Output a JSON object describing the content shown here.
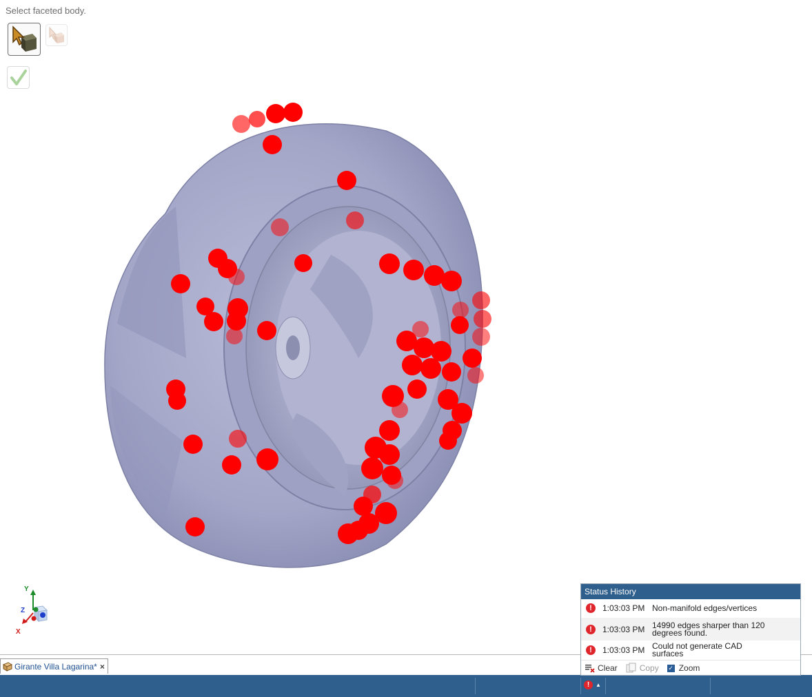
{
  "prompt": {
    "text": "Select faceted body."
  },
  "colors": {
    "accent": "#2f5f8c",
    "error_marker": "#ff0000",
    "model": "#a6a8c9",
    "error_icon": "#e0262d"
  },
  "tools": {
    "select": {
      "icon": "select-body-icon"
    },
    "select_faded": {
      "icon": "select-body-faded-icon"
    },
    "accept": {
      "icon": "checkmark-icon"
    }
  },
  "triad": {
    "y": "Y",
    "z": "Z",
    "x": "X"
  },
  "document_tab": {
    "label": "Girante Villa Lagarina*",
    "close": "×"
  },
  "status_history": {
    "title": "Status History",
    "rows": [
      {
        "time": "1:03:03 PM",
        "message": "Non-manifold edges/vertices"
      },
      {
        "time": "1:03:03 PM",
        "message": "14990 edges sharper than 120 degrees found."
      },
      {
        "time": "1:03:03 PM",
        "message": "Could not generate CAD surfaces"
      }
    ],
    "clear_label": "Clear",
    "copy_label": "Copy",
    "zoom_label": "Zoom",
    "zoom_checked": true
  },
  "status_bar": {
    "caret": "▲"
  }
}
